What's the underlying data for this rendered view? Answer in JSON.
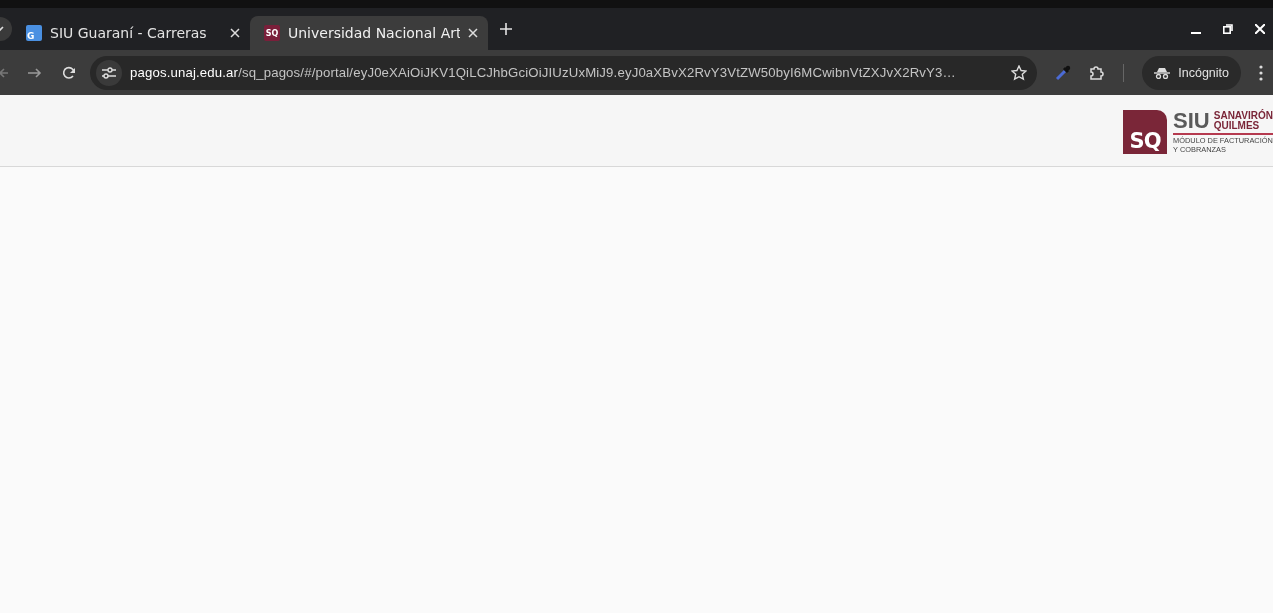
{
  "tabs": [
    {
      "title": "SIU Guaraní - Carreras",
      "kind": "guarani",
      "favicon_text": "G",
      "selected": false
    },
    {
      "title": "Universidad Nacional Art",
      "kind": "sq",
      "favicon_text": "SQ",
      "selected": true
    }
  ],
  "toolbar": {
    "url_host": "pagos.unaj.edu.ar",
    "url_path": "/sq_pagos/#/portal/eyJ0eXAiOiJKV1QiLCJhbGciOiJIUzUxMiJ9.eyJ0aXBvX2RvY3VtZW50byI6MCwibnVtZXJvX2RvY3…",
    "profile_label": "Incógnito"
  },
  "header": {
    "logo": {
      "mark": "SQ",
      "brand": "SIU",
      "name_line_1": "SANAVIRÓN",
      "name_line_2": "QUILMES",
      "subtitle_line_1": "MÓDULO DE FACTURACIÓN",
      "subtitle_line_2": "Y COBRANZAS"
    }
  }
}
